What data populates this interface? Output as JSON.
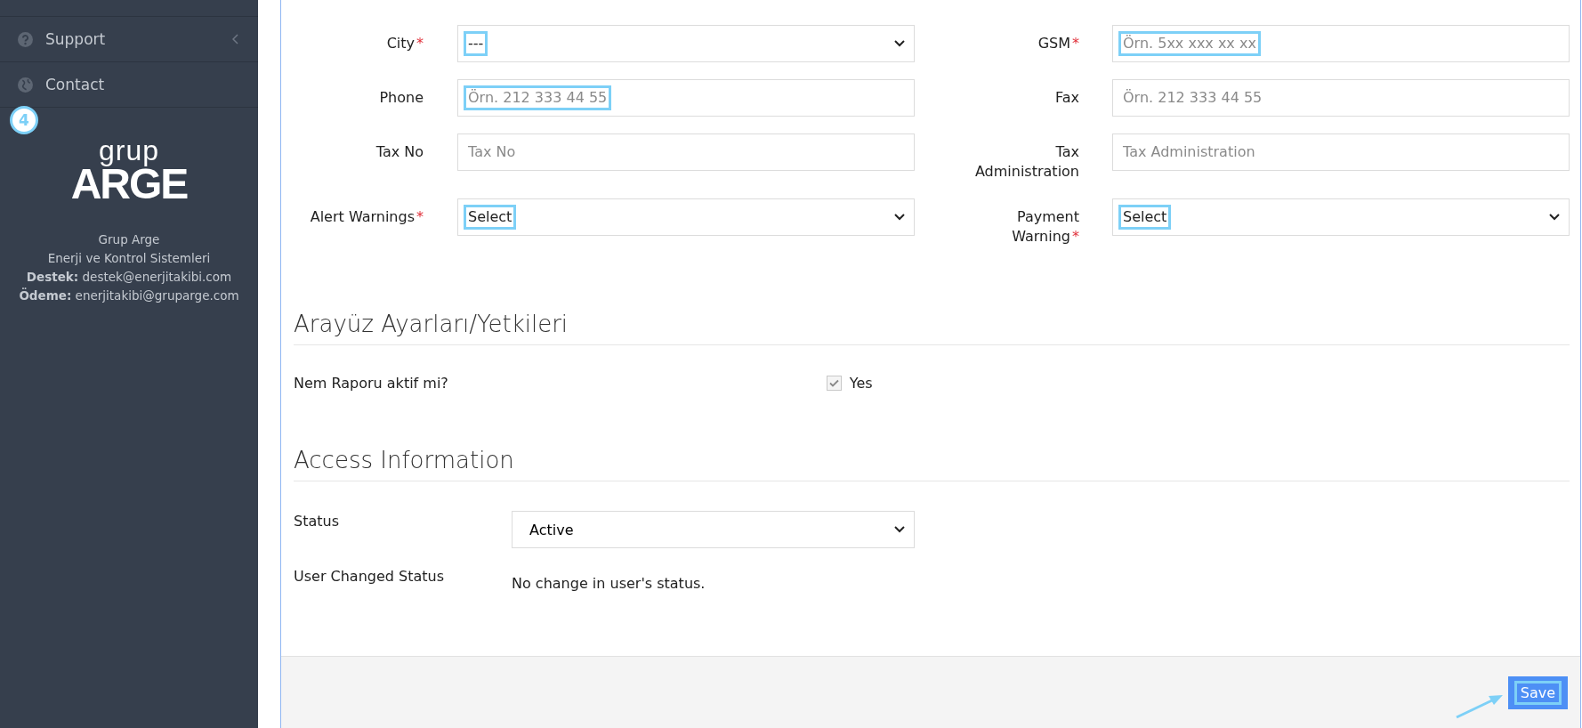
{
  "sidebar": {
    "items": [
      {
        "label": "Support",
        "expandable": true
      },
      {
        "label": "Contact",
        "expandable": false
      }
    ],
    "step_badge": "4",
    "logo": {
      "top": "grup",
      "bottom": "ARGE"
    },
    "company": {
      "name": "Grup Arge",
      "subtitle": "Enerji ve Kontrol Sistemleri",
      "support": "**Destek:** destek@enerjitakibi.com",
      "payment": "**Ödeme:** enerjitakibi@gruparge.com"
    }
  },
  "form": {
    "fields": [
      {
        "label": "City",
        "required_mark": "*",
        "kind": "select",
        "value": "---",
        "highlighted": true
      },
      {
        "label": "GSM",
        "required_mark": "*",
        "kind": "input",
        "placeholder": "Örn. 5xx xxx xx xx",
        "highlighted": true
      },
      {
        "label": "Phone",
        "kind": "input",
        "placeholder": "Örn. 212 333 44 55",
        "highlighted": true
      },
      {
        "label": "Fax",
        "kind": "input",
        "placeholder": "Örn. 212 333 44 55",
        "highlighted": false
      },
      {
        "label": "Tax No",
        "kind": "input",
        "placeholder": "Tax No",
        "highlighted": false
      },
      {
        "label": "Tax Administration",
        "kind": "input",
        "placeholder": "Tax Administration",
        "highlighted": false
      },
      {
        "label": "Alert Warnings",
        "required_mark": "*",
        "kind": "select",
        "value": "Select",
        "highlighted": true
      },
      {
        "label": "Payment Warning",
        "required_mark": "*",
        "kind": "select",
        "value": "Select",
        "highlighted": true
      }
    ]
  },
  "interface_section": {
    "title": "Arayüz Ayarları/Yetkileri",
    "question": "Nem Raporu aktif mi?",
    "checkbox": {
      "label": "Yes",
      "checked": true
    }
  },
  "access_section": {
    "title": "Access Information",
    "status_label": "Status",
    "status_value": "Active",
    "changed_label": "User Changed Status",
    "changed_text": "No change in user's status."
  },
  "footer": {
    "save_button": {
      "label": "Save",
      "highlighted": true
    }
  }
}
